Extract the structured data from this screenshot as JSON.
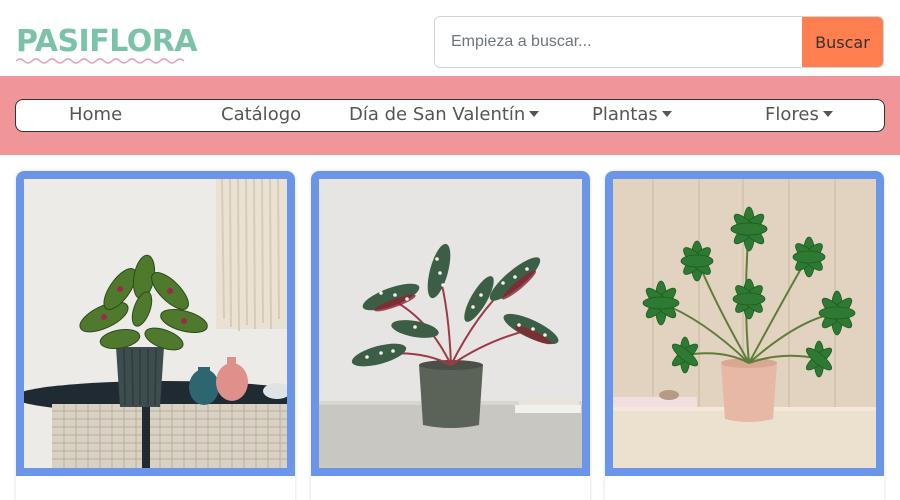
{
  "brand": {
    "name": "PASIFLORA",
    "color": "#7cc2a9"
  },
  "search": {
    "placeholder": "Empieza a buscar...",
    "button_label": "Buscar",
    "button_color": "#ff7f50"
  },
  "nav": {
    "band_color": "#f09598",
    "items": [
      {
        "label": "Home",
        "dropdown": false
      },
      {
        "label": "Catálogo",
        "dropdown": false
      },
      {
        "label": "Día de San Valentín",
        "dropdown": true
      },
      {
        "label": "Plantas",
        "dropdown": true
      },
      {
        "label": "Flores",
        "dropdown": true
      }
    ]
  },
  "products": {
    "frame_color": "#6a95e9",
    "items": [
      {
        "image": "prayer-plant-image"
      },
      {
        "image": "begonia-maculata-image"
      },
      {
        "image": "fatsia-japonica-image"
      }
    ]
  }
}
